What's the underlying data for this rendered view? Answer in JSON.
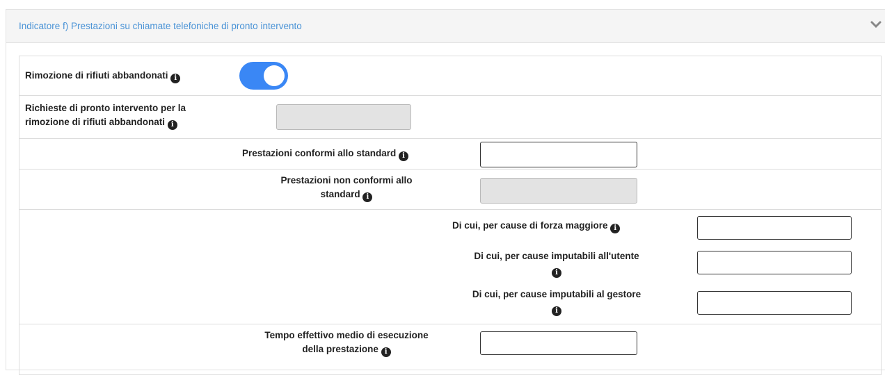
{
  "panel": {
    "title": "Indicatore f) Prestazioni su chiamate telefoniche di pronto intervento",
    "collapse_icon": "chevron-down-icon"
  },
  "rows": {
    "rimozione": {
      "label": "Rimozione di rifiuti abbandonati",
      "toggle_on": true
    },
    "richieste": {
      "label_line1": "Richieste di pronto intervento per la",
      "label_line2": "rimozione di rifiuti abbandonati",
      "value": ""
    },
    "conformi": {
      "label": "Prestazioni conformi allo standard",
      "value": ""
    },
    "non_conformi": {
      "label_line1": "Prestazioni non conformi allo",
      "label_line2": "standard",
      "value": ""
    },
    "forza_maggiore": {
      "label": "Di cui, per cause di forza maggiore",
      "value": ""
    },
    "utente": {
      "label": "Di cui, per cause imputabili all'utente",
      "value": ""
    },
    "gestore": {
      "label": "Di cui, per cause imputabili al gestore",
      "value": ""
    },
    "tempo": {
      "label_line1": "Tempo effettivo medio di esecuzione",
      "label_line2": "della prestazione",
      "value": ""
    }
  },
  "colors": {
    "link": "#4a93d6",
    "toggle": "#3a87f5",
    "disabled_bg": "#e3e3e3"
  },
  "info_icon": "info-circle-icon"
}
